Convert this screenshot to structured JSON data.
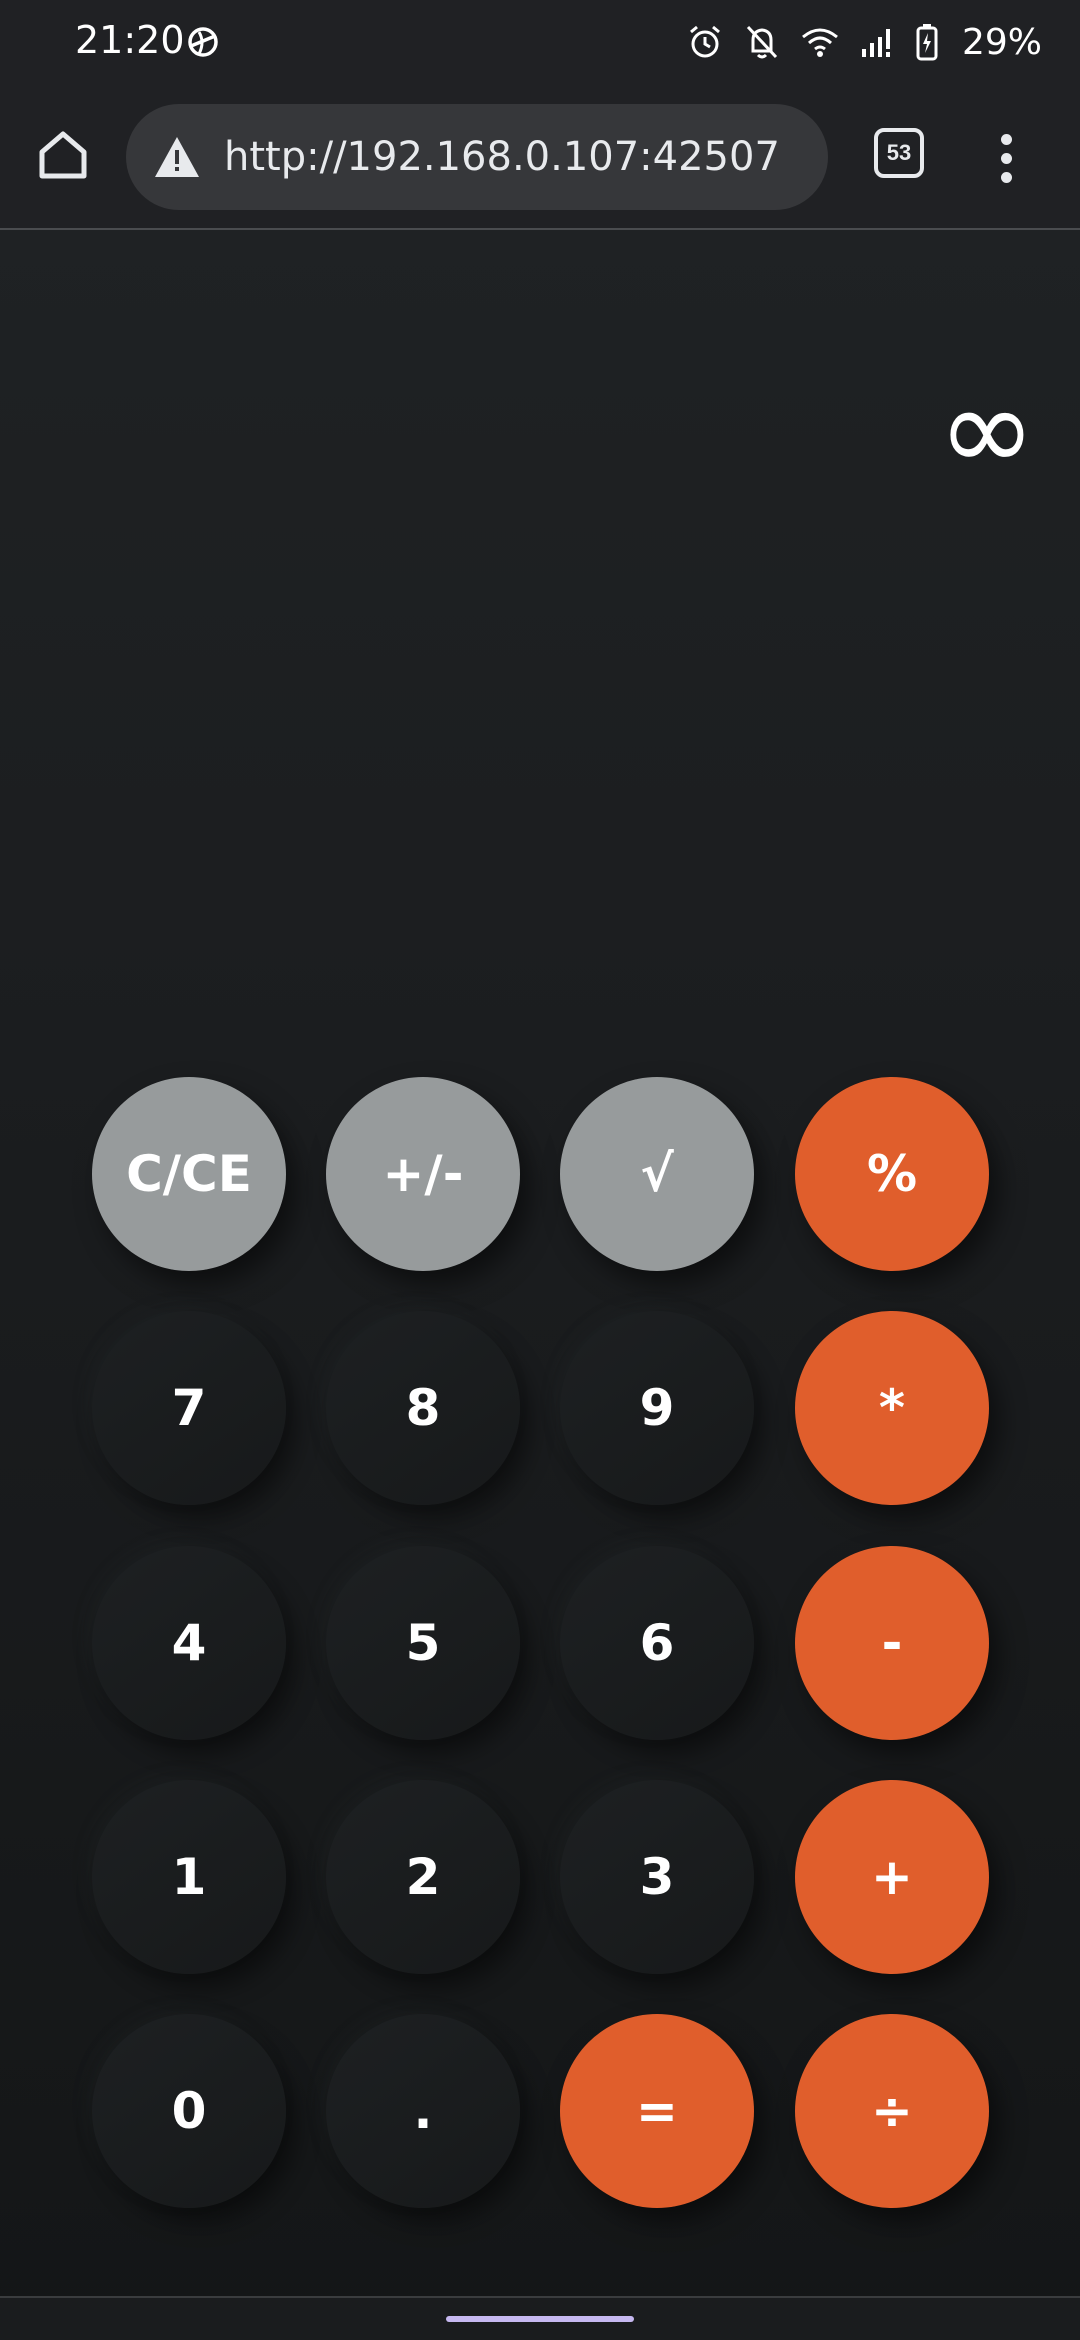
{
  "status_bar": {
    "time": "21:20",
    "left_icon": "sync-globe-icon",
    "icons": [
      "alarm-icon",
      "bell-off-icon",
      "wifi-icon",
      "cellular-signal-icon",
      "battery-charging-icon"
    ],
    "battery_percent": "29%"
  },
  "browser": {
    "url": "http://192.168.0.107:42507",
    "security_icon": "warning-triangle-icon",
    "tab_count": "53",
    "home_icon": "home-icon",
    "menu_icon": "more-vert-icon"
  },
  "calculator": {
    "display_value": "∞",
    "keys": {
      "clear": "C/CE",
      "sign": "+/-",
      "sqrt": "√",
      "percent": "%",
      "seven": "7",
      "eight": "8",
      "nine": "9",
      "multiply": "*",
      "four": "4",
      "five": "5",
      "six": "6",
      "subtract": "-",
      "one": "1",
      "two": "2",
      "three": "3",
      "add": "+",
      "zero": "0",
      "decimal": ".",
      "equals": "=",
      "divide": "÷"
    }
  },
  "colors": {
    "accent": "#e05e2c",
    "function_key": "#979b9c",
    "digit_key": "#1b1d1f",
    "background": "#1c1e20",
    "gesture_pill": "#c6b8f0"
  }
}
